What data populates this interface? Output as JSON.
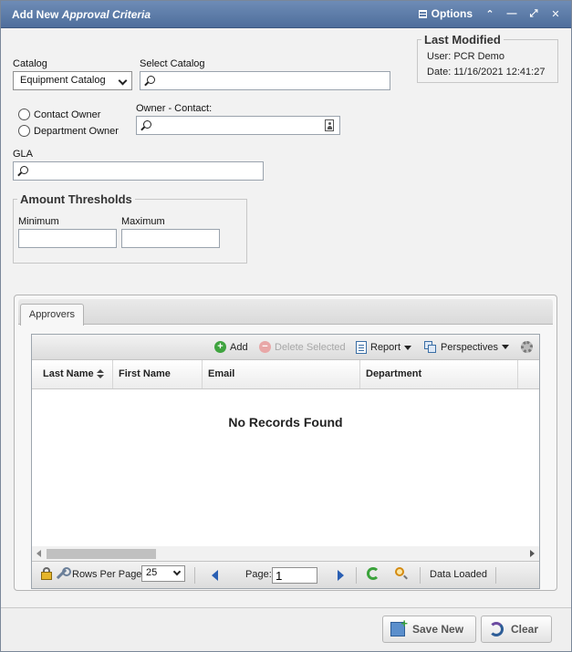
{
  "window": {
    "title_prefix": "Add New",
    "title_emph": "Approval Criteria",
    "options_label": "Options"
  },
  "form": {
    "catalog_label": "Catalog",
    "catalog_value": "Equipment Catalog",
    "select_catalog_label": "Select Catalog",
    "contact_owner_label": "Contact Owner",
    "department_owner_label": "Department Owner",
    "owner_contact_label": "Owner - Contact:",
    "gla_label": "GLA",
    "thresholds_title": "Amount Thresholds",
    "minimum_label": "Minimum",
    "maximum_label": "Maximum"
  },
  "last_modified": {
    "title": "Last Modified",
    "user": "User: PCR Demo",
    "date": "Date: 11/16/2021 12:41:27"
  },
  "tabs": [
    {
      "label": "Approvers"
    }
  ],
  "grid": {
    "toolbar": {
      "add": "Add",
      "delete_selected": "Delete Selected",
      "report": "Report",
      "perspectives": "Perspectives"
    },
    "columns": [
      "Last Name",
      "First Name",
      "Email",
      "Department"
    ],
    "empty_text": "No Records Found",
    "pager": {
      "rows_per_page_label": "Rows Per Page:",
      "rows_per_page_value": "25",
      "page_label": "Page:",
      "page_value": "1",
      "status": "Data Loaded"
    }
  },
  "footer": {
    "save_new": "Save New",
    "clear": "Clear"
  }
}
